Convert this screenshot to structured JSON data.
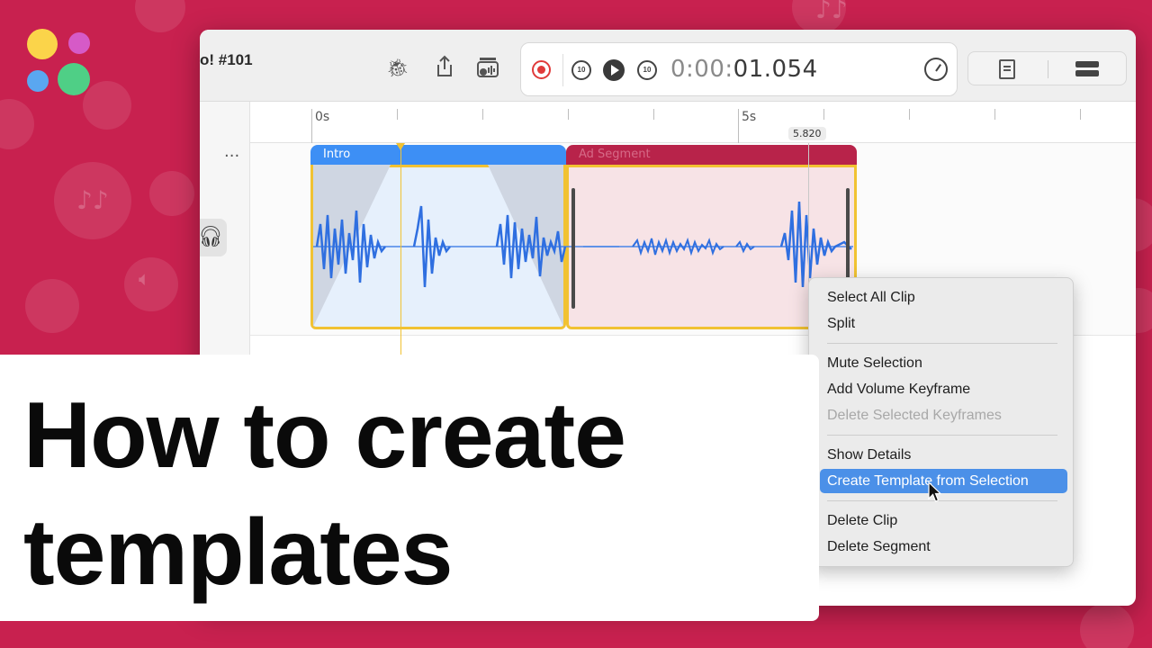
{
  "theme": {
    "background": "#c8214f",
    "accent_blue": "#3d8ff5",
    "accent_red": "#b8234a",
    "selection_yellow": "#f1c232",
    "menu_highlight": "#4b90e8"
  },
  "logo": {
    "icon": "four-color-dots-logo-icon",
    "colors": [
      "#fbd44a",
      "#d65ac7",
      "#5aa7f0",
      "#4fcf86"
    ]
  },
  "window": {
    "title": "o! #101",
    "toolbar": {
      "icons": [
        "bug-icon",
        "share-icon",
        "audio-library-icon"
      ],
      "transport": {
        "record_icon": "record-icon",
        "skip_back_label": "10",
        "play_icon": "play-icon",
        "skip_forward_label": "10",
        "timecode_dim": "0:00:",
        "timecode_strong": "01.054",
        "speed_icon": "speed-gauge-icon"
      },
      "view_icons": [
        "document-view-icon",
        "rows-view-icon"
      ]
    }
  },
  "timeline": {
    "ruler_labels": [
      "0s",
      "5s"
    ],
    "playhead_time": "5.820",
    "track_more": "···",
    "headphones_icon": "headphones-icon",
    "segments": [
      {
        "name": "Intro",
        "color": "#3d8ff5"
      },
      {
        "name": "Ad Segment",
        "color": "#b8234a"
      }
    ]
  },
  "context_menu": {
    "items": [
      {
        "label": "Select All Clip",
        "state": "normal"
      },
      {
        "label": "Split",
        "state": "normal"
      },
      {
        "label": "Mute Selection",
        "state": "normal"
      },
      {
        "label": "Add Volume Keyframe",
        "state": "normal"
      },
      {
        "label": "Delete Selected Keyframes",
        "state": "disabled"
      },
      {
        "label": "Show Details",
        "state": "normal"
      },
      {
        "label": "Create Template from Selection",
        "state": "highlighted"
      },
      {
        "label": "Delete Clip",
        "state": "normal"
      },
      {
        "label": "Delete Segment",
        "state": "normal"
      }
    ]
  },
  "title_card": {
    "line1": "How to create",
    "line2": "templates"
  }
}
